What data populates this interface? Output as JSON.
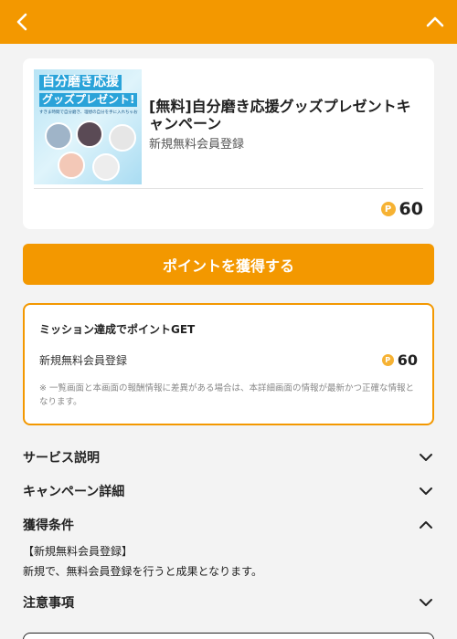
{
  "header": {
    "back_icon": "chevron-left-icon",
    "collapse_icon": "chevron-up-icon",
    "bg_color": "#f39800"
  },
  "campaign": {
    "thumbnail": {
      "title_line1": "自分磨き応援",
      "title_line2": "グッズプレゼント!",
      "caption": "すきま時間で自分磨き、理想の自分を手に入れちゃお!"
    },
    "title": "[無料]自分磨き応援グッズプレゼントキャンペーン",
    "subtitle": "新規無料会員登録",
    "points": "60",
    "point_icon": "P"
  },
  "cta": {
    "label": "ポイントを獲得する",
    "color": "#f39800"
  },
  "mission": {
    "title": "ミッション達成でポイントGET",
    "item_label": "新規無料会員登録",
    "item_points": "60",
    "point_icon": "P",
    "note": "※ 一覧画面と本画面の報酬情報に差異がある場合は、本詳細画面の情報が最新かつ正確な情報となります。"
  },
  "sections": {
    "service": {
      "label": "サービス説明",
      "state": "collapsed"
    },
    "campaign_detail": {
      "label": "キャンペーン詳細",
      "state": "collapsed"
    },
    "conditions": {
      "label": "獲得条件",
      "state": "expanded",
      "line1": "【新規無料会員登録】",
      "line2": "新規で、無料会員登録を行うと成果となります。"
    },
    "notes": {
      "label": "注意事項",
      "state": "collapsed"
    }
  }
}
